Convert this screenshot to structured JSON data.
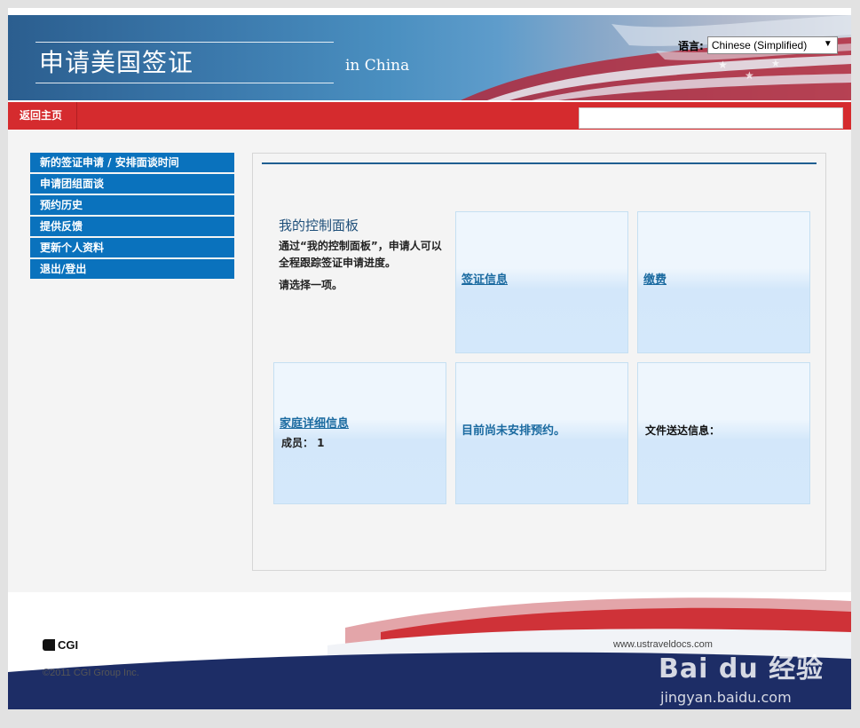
{
  "header": {
    "title": "申请美国签证",
    "subtitle": "in China",
    "language_label": "语言:",
    "language_value": "Chinese (Simplified)"
  },
  "topnav": {
    "home_label": "返回主页"
  },
  "sidebar": {
    "items": [
      {
        "label": "新的签证申请 / 安排面谈时间"
      },
      {
        "label": "申请团组面谈"
      },
      {
        "label": "预约历史"
      },
      {
        "label": "提供反馈"
      },
      {
        "label": "更新个人资料"
      },
      {
        "label": "退出/登出"
      }
    ]
  },
  "dashboard": {
    "heading": "我的控制面板",
    "description": "通过“我的控制面板”，申请人可以全程跟踪签证申请进度。",
    "prompt": "请选择一项。",
    "tiles": {
      "visa_info": "签证信息",
      "payment": "缴费",
      "family": "家庭详细信息",
      "members": "成员： 1",
      "appointment": "目前尚未安排预约。",
      "delivery": "文件送达信息："
    }
  },
  "footer": {
    "brand": "CGI",
    "copyright": "©2011 CGI Group Inc.",
    "url": "www.ustraveldocs.com"
  },
  "watermark": {
    "logo_text": "Bai du 经验",
    "url": "jingyan.baidu.com"
  },
  "colors": {
    "nav_blue": "#0a72bd",
    "red_bar": "#d52b2e",
    "heading_blue": "#1f4f7a",
    "link_blue": "#1a6aa0",
    "footer_navy": "#1d2d66"
  }
}
